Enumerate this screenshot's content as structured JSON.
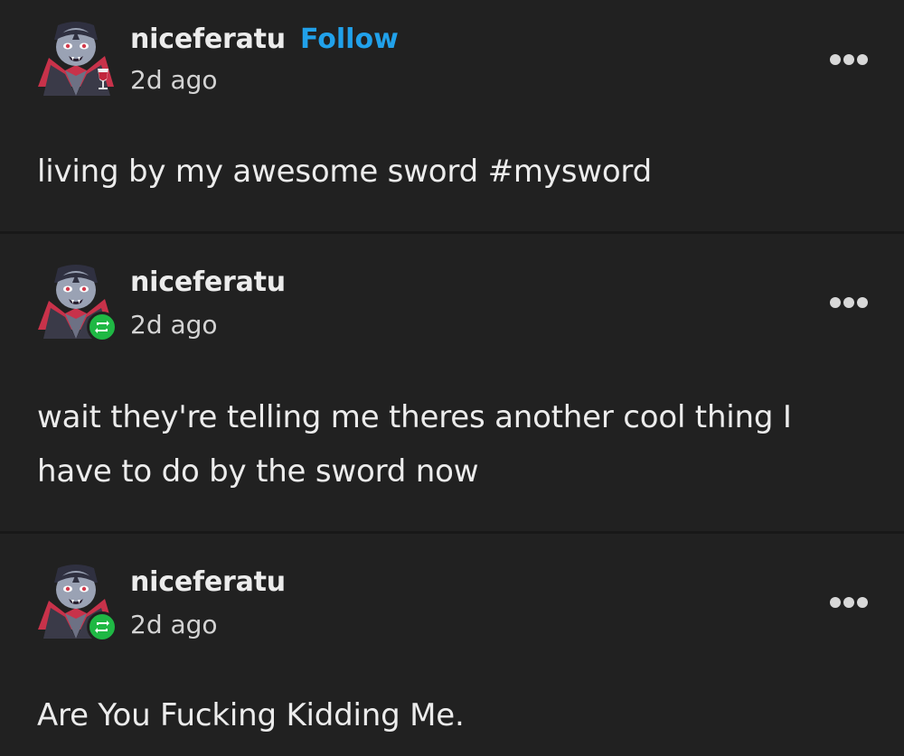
{
  "posts": [
    {
      "username": "niceferatu",
      "follow_label": "Follow",
      "timestamp": "2d ago",
      "body": "living by my awesome sword #mysword",
      "avatar_icon": "vampire-avatar-icon",
      "more_icon": "more-options-icon"
    },
    {
      "username": "niceferatu",
      "timestamp": "2d ago",
      "body": "wait they're telling me theres another cool thing I have to do by the sword now",
      "avatar_icon": "vampire-avatar-icon",
      "badge_icon": "reblog-icon",
      "more_icon": "more-options-icon"
    },
    {
      "username": "niceferatu",
      "timestamp": "2d ago",
      "body": "Are You Fucking Kidding Me.",
      "avatar_icon": "vampire-avatar-icon",
      "badge_icon": "reblog-icon",
      "more_icon": "more-options-icon"
    }
  ],
  "colors": {
    "background": "#212121",
    "text": "#ececec",
    "follow": "#21a1ea",
    "reblog_badge": "#1fb844"
  }
}
